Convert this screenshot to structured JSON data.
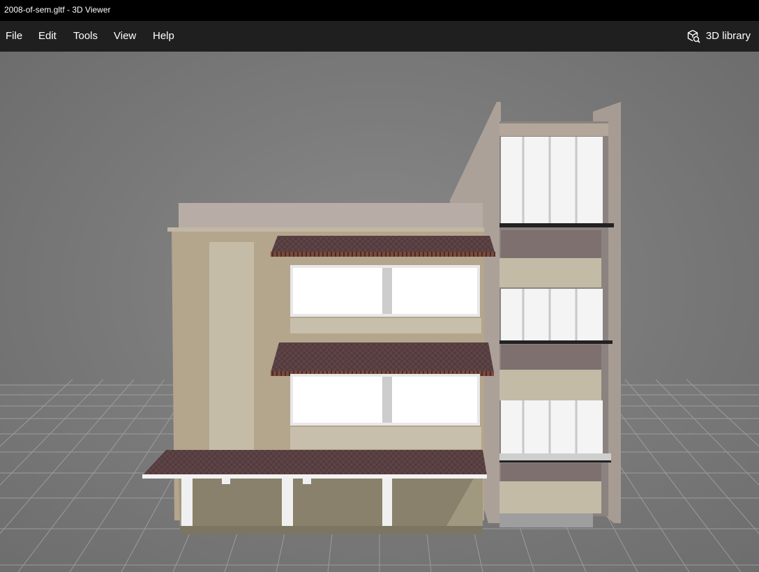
{
  "window": {
    "title": "2008-of-sem.gltf - 3D Viewer"
  },
  "menu": {
    "items": [
      "File",
      "Edit",
      "Tools",
      "View",
      "Help"
    ]
  },
  "toolbar": {
    "library_label": "3D library",
    "library_icon": "cube-search-icon"
  },
  "scene": {
    "model": "building",
    "background_color": "#7a7a7a",
    "grid_color": "#9a9a9a"
  }
}
